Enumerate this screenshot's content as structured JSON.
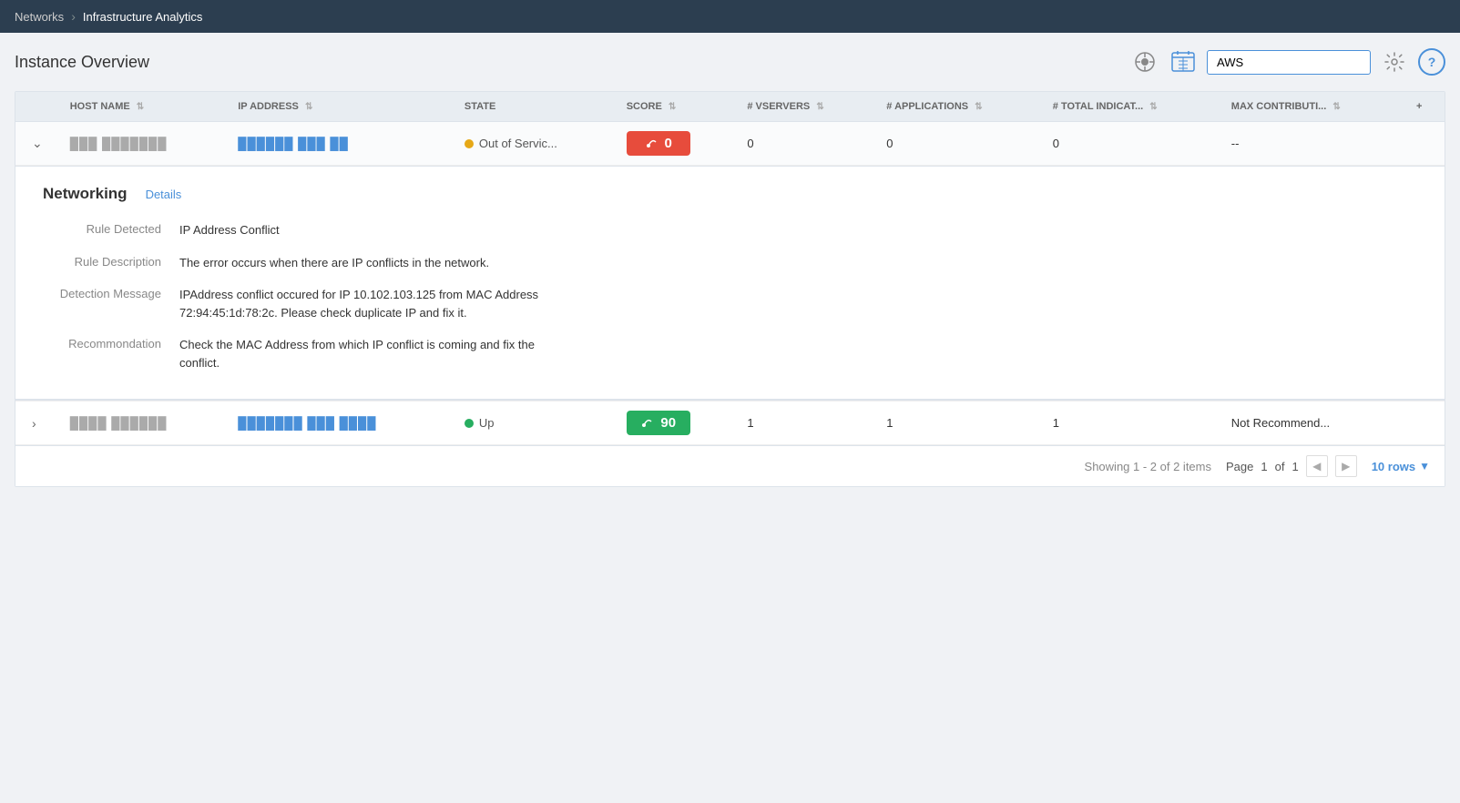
{
  "nav": {
    "parent": "Networks",
    "separator": "›",
    "current": "Infrastructure Analytics"
  },
  "header": {
    "title": "Instance Overview",
    "search_placeholder": "AWS",
    "search_value": "AWS"
  },
  "table": {
    "columns": [
      {
        "key": "expand",
        "label": ""
      },
      {
        "key": "hostname",
        "label": "HOST NAME",
        "sortable": true
      },
      {
        "key": "ip",
        "label": "IP ADDRESS",
        "sortable": true
      },
      {
        "key": "state",
        "label": "STATE",
        "sortable": false
      },
      {
        "key": "score",
        "label": "SCORE",
        "sortable": true
      },
      {
        "key": "vservers",
        "label": "# VSERVERS",
        "sortable": true
      },
      {
        "key": "applications",
        "label": "# APPLICATIONS",
        "sortable": true
      },
      {
        "key": "indicators",
        "label": "# TOTAL INDICAT...",
        "sortable": true
      },
      {
        "key": "contribution",
        "label": "MAX CONTRIBUTI...",
        "sortable": true
      }
    ],
    "add_column_label": "+",
    "rows": [
      {
        "id": "row1",
        "hostname": "███ ███████",
        "ip": "██████ ███ ██",
        "state": "Out of Servic...",
        "state_type": "yellow",
        "score": 0,
        "score_type": "red",
        "vservers": 0,
        "applications": 0,
        "indicators": 0,
        "contribution": "--",
        "expanded": true
      },
      {
        "id": "row2",
        "hostname": "████ ██████",
        "ip": "███████ ███ ████",
        "state": "Up",
        "state_type": "green",
        "score": 90,
        "score_type": "green",
        "vservers": 1,
        "applications": 1,
        "indicators": 1,
        "contribution": "Not Recommend...",
        "expanded": false
      }
    ],
    "detail": {
      "title": "Networking",
      "details_link": "Details",
      "rule_detected_label": "Rule Detected",
      "rule_detected_value": "IP Address Conflict",
      "rule_description_label": "Rule Description",
      "rule_description_value": "The error occurs when there are IP conflicts in the network.",
      "detection_message_label": "Detection Message",
      "detection_message_value": "IPAddress conflict occured for IP 10.102.103.125 from MAC Address 72:94:45:1d:78:2c. Please check duplicate IP and fix it.",
      "recommendation_label": "Recommondation",
      "recommendation_value": "Check the MAC Address from which IP conflict is coming and fix the conflict."
    }
  },
  "pagination": {
    "showing_text": "Showing 1 - 2 of 2 items",
    "page_label": "Page",
    "page_current": "1",
    "page_of": "of",
    "page_total": "1",
    "rows_per_page": "10 rows"
  },
  "icons": {
    "settings": "⚙",
    "help": "?",
    "chevron_down": "▼",
    "chevron_left": "◀",
    "chevron_right": "▶",
    "expand_right": "›",
    "expand_down": "⌄",
    "score_up": "↑",
    "sort_updown": "⇅"
  }
}
